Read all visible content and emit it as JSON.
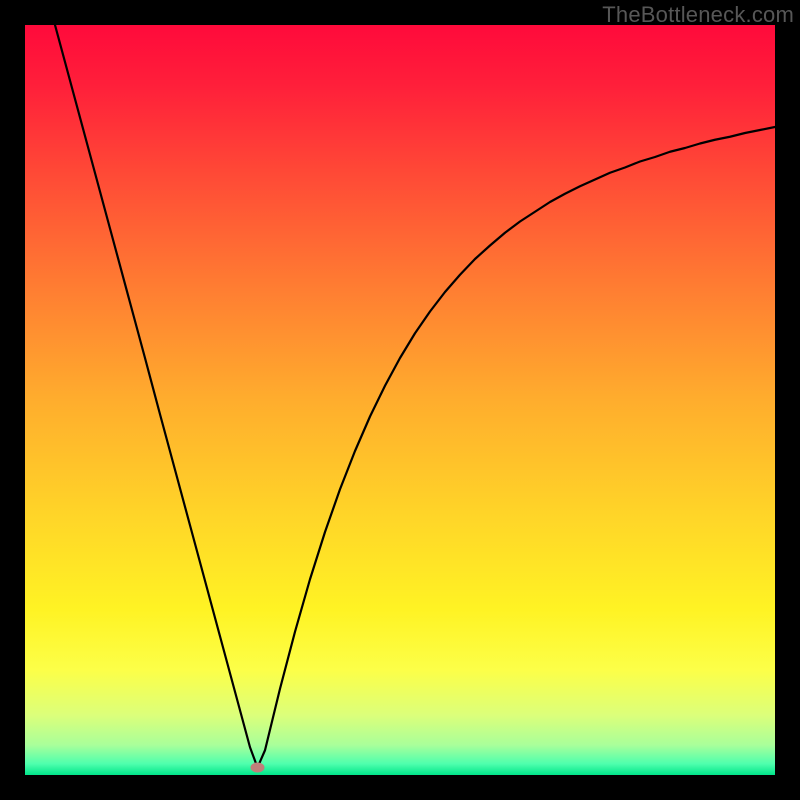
{
  "watermark": "TheBottleneck.com",
  "chart_data": {
    "type": "line",
    "title": "",
    "xlabel": "",
    "ylabel": "",
    "xlim": [
      0,
      100
    ],
    "ylim": [
      0,
      100
    ],
    "background_gradient": {
      "stops": [
        {
          "offset": 0.0,
          "color": "#ff0a3b"
        },
        {
          "offset": 0.08,
          "color": "#ff1f3a"
        },
        {
          "offset": 0.2,
          "color": "#ff4a36"
        },
        {
          "offset": 0.35,
          "color": "#ff7d32"
        },
        {
          "offset": 0.5,
          "color": "#ffad2d"
        },
        {
          "offset": 0.65,
          "color": "#ffd428"
        },
        {
          "offset": 0.78,
          "color": "#fff324"
        },
        {
          "offset": 0.86,
          "color": "#fcff48"
        },
        {
          "offset": 0.92,
          "color": "#dcff7a"
        },
        {
          "offset": 0.96,
          "color": "#a9ff9a"
        },
        {
          "offset": 0.985,
          "color": "#4fffad"
        },
        {
          "offset": 1.0,
          "color": "#00e58a"
        }
      ]
    },
    "marker": {
      "x": 31,
      "y": 1.0,
      "color": "#c07f7a",
      "rx": 7,
      "ry": 5
    },
    "curve": {
      "minimum_x": 31,
      "points": [
        {
          "x": 4.0,
          "y": 100.0
        },
        {
          "x": 6.0,
          "y": 92.6
        },
        {
          "x": 8.0,
          "y": 85.2
        },
        {
          "x": 10.0,
          "y": 77.8
        },
        {
          "x": 12.0,
          "y": 70.4
        },
        {
          "x": 14.0,
          "y": 63.0
        },
        {
          "x": 16.0,
          "y": 55.6
        },
        {
          "x": 18.0,
          "y": 48.1
        },
        {
          "x": 20.0,
          "y": 40.7
        },
        {
          "x": 22.0,
          "y": 33.3
        },
        {
          "x": 24.0,
          "y": 25.9
        },
        {
          "x": 26.0,
          "y": 18.5
        },
        {
          "x": 28.0,
          "y": 11.1
        },
        {
          "x": 30.0,
          "y": 3.7
        },
        {
          "x": 31.0,
          "y": 1.0
        },
        {
          "x": 32.0,
          "y": 3.3
        },
        {
          "x": 34.0,
          "y": 11.5
        },
        {
          "x": 36.0,
          "y": 19.1
        },
        {
          "x": 38.0,
          "y": 26.1
        },
        {
          "x": 40.0,
          "y": 32.4
        },
        {
          "x": 42.0,
          "y": 38.1
        },
        {
          "x": 44.0,
          "y": 43.2
        },
        {
          "x": 46.0,
          "y": 47.8
        },
        {
          "x": 48.0,
          "y": 51.9
        },
        {
          "x": 50.0,
          "y": 55.6
        },
        {
          "x": 52.0,
          "y": 58.9
        },
        {
          "x": 54.0,
          "y": 61.8
        },
        {
          "x": 56.0,
          "y": 64.4
        },
        {
          "x": 58.0,
          "y": 66.7
        },
        {
          "x": 60.0,
          "y": 68.8
        },
        {
          "x": 62.0,
          "y": 70.6
        },
        {
          "x": 64.0,
          "y": 72.3
        },
        {
          "x": 66.0,
          "y": 73.8
        },
        {
          "x": 68.0,
          "y": 75.1
        },
        {
          "x": 70.0,
          "y": 76.4
        },
        {
          "x": 72.0,
          "y": 77.5
        },
        {
          "x": 74.0,
          "y": 78.5
        },
        {
          "x": 76.0,
          "y": 79.4
        },
        {
          "x": 78.0,
          "y": 80.3
        },
        {
          "x": 80.0,
          "y": 81.0
        },
        {
          "x": 82.0,
          "y": 81.8
        },
        {
          "x": 84.0,
          "y": 82.4
        },
        {
          "x": 86.0,
          "y": 83.1
        },
        {
          "x": 88.0,
          "y": 83.6
        },
        {
          "x": 90.0,
          "y": 84.2
        },
        {
          "x": 92.0,
          "y": 84.7
        },
        {
          "x": 94.0,
          "y": 85.1
        },
        {
          "x": 96.0,
          "y": 85.6
        },
        {
          "x": 98.0,
          "y": 86.0
        },
        {
          "x": 100.0,
          "y": 86.4
        }
      ]
    }
  }
}
